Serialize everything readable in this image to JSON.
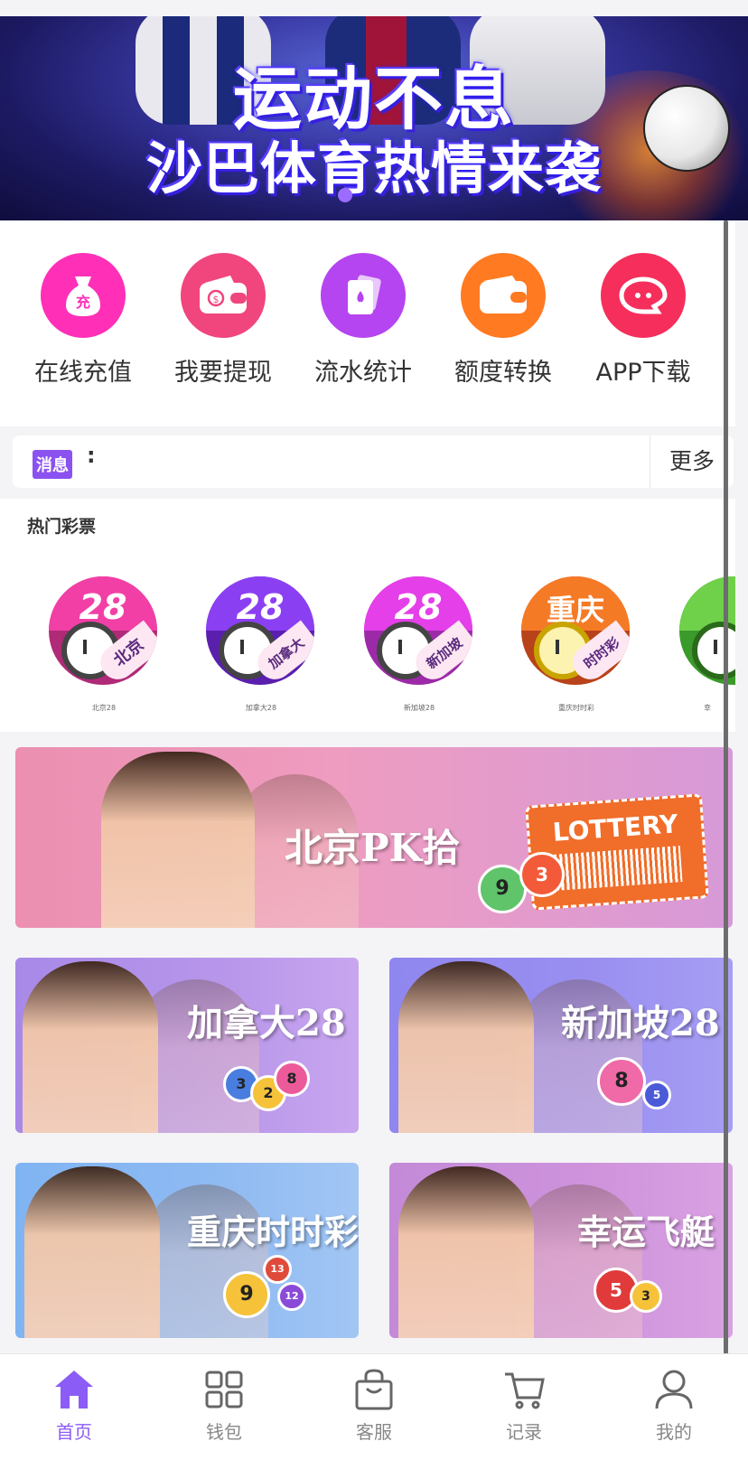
{
  "banner": {
    "line1": "运动不息",
    "line2": "沙巴体育热情来袭"
  },
  "quick_menu": [
    {
      "label": "在线充值",
      "icon": "money-bag-icon",
      "color": "#ff2fb8",
      "glyph": "充"
    },
    {
      "label": "我要提现",
      "icon": "wallet-icon",
      "color": "#f0457d"
    },
    {
      "label": "流水统计",
      "icon": "playing-cards-icon",
      "color": "#b545f0"
    },
    {
      "label": "额度转换",
      "icon": "wallet-transfer-icon",
      "color": "#ff7a21"
    },
    {
      "label": "APP下载",
      "icon": "app-chat-icon",
      "color": "#f52e5b"
    }
  ],
  "notice": {
    "tag": "消息",
    "colon": ":",
    "more": "更多"
  },
  "hot": {
    "title": "热门彩票",
    "items": [
      {
        "name": "北京28",
        "num": "28",
        "sub": "北京",
        "top_color": "#f23fa6",
        "bottom_color": "#b02a78"
      },
      {
        "name": "加拿大28",
        "num": "28",
        "sub": "加拿大",
        "top_color": "#8b3ff2",
        "bottom_color": "#5b1fae"
      },
      {
        "name": "新加坡28",
        "num": "28",
        "sub": "新加坡",
        "top_color": "#e43fe8",
        "bottom_color": "#9c2aa8"
      },
      {
        "name": "重庆时时彩",
        "num": "重庆",
        "sub": "时时彩",
        "top_color": "#f57a26",
        "bottom_color": "#b8431a"
      },
      {
        "name": "幸",
        "num": "",
        "sub": "",
        "top_color": "#6fd04a",
        "bottom_color": "#3a9a2a"
      }
    ]
  },
  "promos": [
    {
      "title": "北京PK拾",
      "extra": "LOTTERY"
    },
    {
      "title": "加拿大28"
    },
    {
      "title": "新加坡28"
    },
    {
      "title": "重庆时时彩"
    },
    {
      "title": "幸运飞艇"
    }
  ],
  "tabs": [
    {
      "label": "首页",
      "icon": "home-icon",
      "active": true
    },
    {
      "label": "钱包",
      "icon": "grid-icon"
    },
    {
      "label": "客服",
      "icon": "bag-icon"
    },
    {
      "label": "记录",
      "icon": "cart-icon"
    },
    {
      "label": "我的",
      "icon": "user-icon"
    }
  ],
  "accent": "#8b5cf6"
}
